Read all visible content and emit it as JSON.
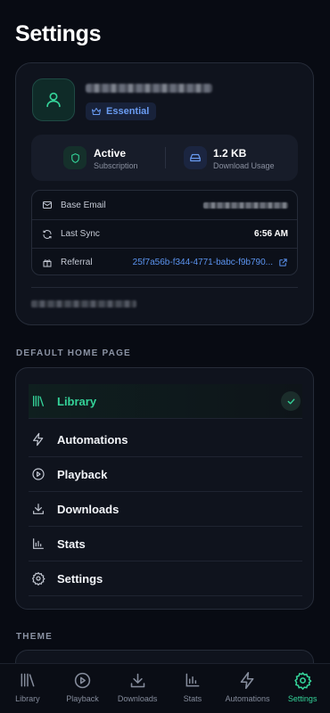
{
  "page": {
    "title": "Settings"
  },
  "account": {
    "tier": "Essential",
    "subscription": {
      "value": "Active",
      "label": "Subscription"
    },
    "usage": {
      "value": "1.2 KB",
      "label": "Download Usage"
    },
    "base_email_label": "Base Email",
    "last_sync_label": "Last Sync",
    "last_sync_value": "6:56 AM",
    "referral_label": "Referral",
    "referral_value": "25f7a56b-f344-4771-babc-f9b790..."
  },
  "sections": {
    "default_home": "DEFAULT HOME PAGE",
    "theme": "THEME"
  },
  "home_pages": [
    {
      "label": "Library",
      "icon": "library-icon",
      "selected": true
    },
    {
      "label": "Automations",
      "icon": "bolt-icon",
      "selected": false
    },
    {
      "label": "Playback",
      "icon": "play-circle-icon",
      "selected": false
    },
    {
      "label": "Downloads",
      "icon": "download-icon",
      "selected": false
    },
    {
      "label": "Stats",
      "icon": "bar-chart-icon",
      "selected": false
    },
    {
      "label": "Settings",
      "icon": "gear-icon",
      "selected": false
    }
  ],
  "tabs": [
    {
      "label": "Library",
      "icon": "library-icon",
      "active": false
    },
    {
      "label": "Playback",
      "icon": "play-circle-icon",
      "active": false
    },
    {
      "label": "Downloads",
      "icon": "download-icon",
      "active": false
    },
    {
      "label": "Stats",
      "icon": "bar-chart-icon",
      "active": false
    },
    {
      "label": "Automations",
      "icon": "bolt-icon",
      "active": false
    },
    {
      "label": "Settings",
      "icon": "gear-icon",
      "active": true
    }
  ],
  "colors": {
    "accent": "#34d399",
    "link": "#5b93ef",
    "badge_text": "#6a9cf2",
    "background": "#080b13",
    "card": "#0f131d"
  }
}
